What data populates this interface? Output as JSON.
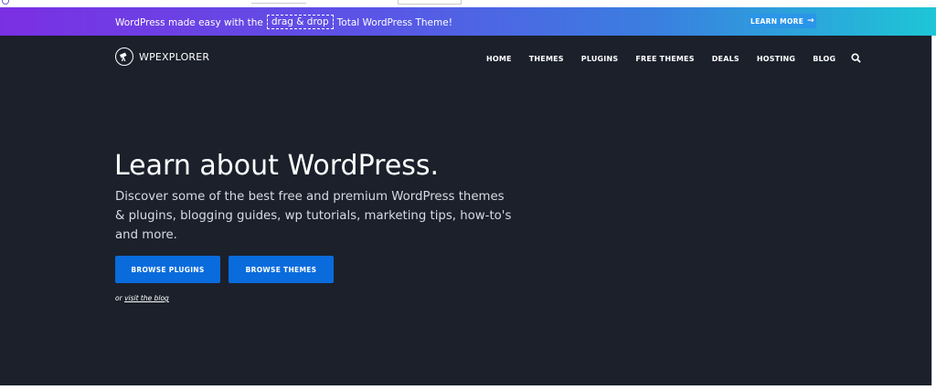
{
  "promo_bar": {
    "text_before": "WordPress made easy with the",
    "highlight": "drag & drop",
    "text_after": "Total WordPress Theme!",
    "button_label": "LEARN MORE",
    "button_icon": "arrow-right-icon",
    "colors": {
      "gradient_start": "#7b2fe3",
      "gradient_end": "#1ec6d6",
      "button_bg": "#2b95e8"
    }
  },
  "header": {
    "logo_icon": "telescope-icon",
    "logo_text": "WPEXPLORER",
    "nav": [
      "HOME",
      "THEMES",
      "PLUGINS",
      "FREE THEMES",
      "DEALS",
      "HOSTING",
      "BLOG"
    ],
    "search_icon": "search-icon"
  },
  "hero": {
    "title": "Learn about WordPress.",
    "description": "Discover some of the best free and premium WordPress themes & plugins, blogging guides, wp tutorials, marketing tips, how-to's and more.",
    "buttons": {
      "plugins": "BROWSE PLUGINS",
      "themes": "BROWSE THEMES"
    },
    "or_text": "or",
    "blog_link": "visit the blog",
    "colors": {
      "background": "#1b202b",
      "button_bg": "#0a6bdc"
    }
  }
}
